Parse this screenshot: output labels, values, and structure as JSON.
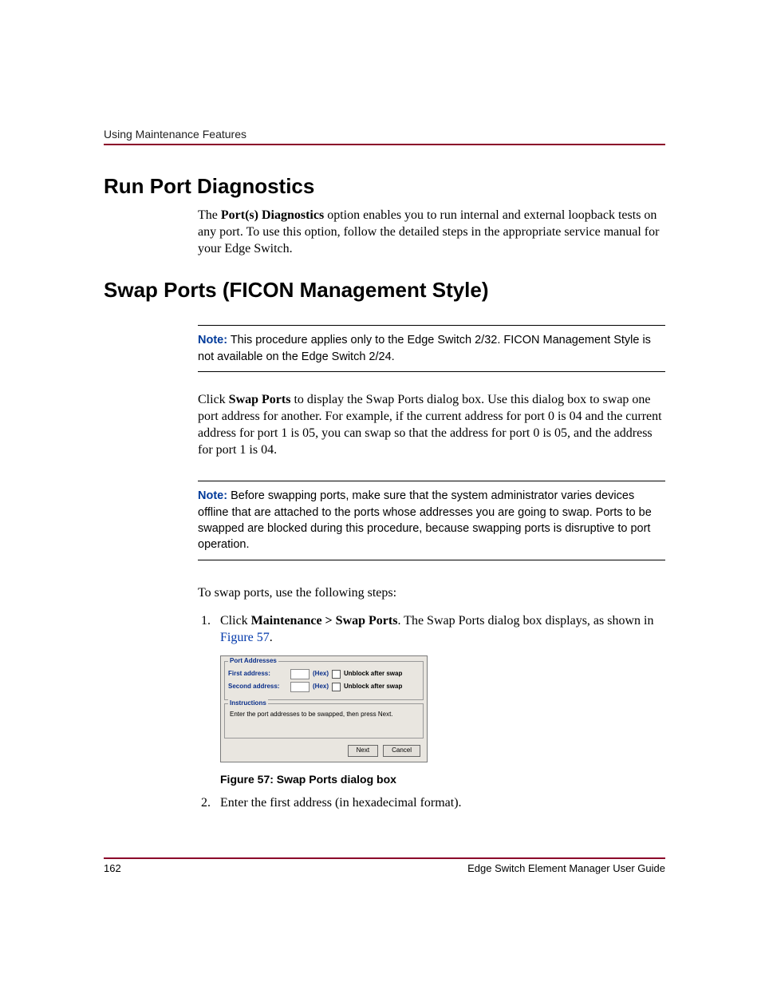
{
  "runningHead": "Using Maintenance Features",
  "section1": {
    "heading": "Run Port Diagnostics",
    "para_pre": "The ",
    "para_bold": "Port(s) Diagnostics",
    "para_post": " option enables you to run internal and external loopback tests on any port. To use this option, follow the detailed steps in the appropriate service manual for your Edge Switch."
  },
  "section2": {
    "heading": "Swap Ports (FICON Management Style)",
    "note1_label": "Note:",
    "note1_text": "  This procedure applies only to the Edge Switch 2/32. FICON Management Style is not available on the Edge Switch 2/24.",
    "para_pre": "Click ",
    "para_bold": "Swap Ports",
    "para_post": " to display the Swap Ports dialog box. Use this dialog box to swap one port address for another. For example, if the current address for port 0 is 04 and the current address for port 1 is 05, you can swap so that the address for port 0 is 05, and the address for port 1 is 04.",
    "note2_label": "Note:",
    "note2_text": "  Before swapping ports, make sure that the system administrator varies devices offline that are attached to the ports whose addresses you are going to swap. Ports to be swapped are blocked during this procedure, because swapping ports is disruptive to port operation.",
    "lead": "To swap ports, use the following steps:",
    "step1_pre": "Click ",
    "step1_bold": "Maintenance > Swap Ports",
    "step1_mid": ". The Swap Ports dialog box displays, as shown in ",
    "step1_link": "Figure 57",
    "step1_post": ".",
    "step2": "Enter the first address (in hexadecimal format).",
    "figcap": "Figure 57:  Swap Ports dialog box"
  },
  "dialog": {
    "group1_legend": "Port Addresses",
    "row1_label": "First address:",
    "row2_label": "Second address:",
    "hex": "(Hex)",
    "unblock": "Unblock after swap",
    "group2_legend": "Instructions",
    "instructions": "Enter the port addresses to be swapped, then press Next.",
    "btn_next": "Next",
    "btn_cancel": "Cancel"
  },
  "footer": {
    "pageNum": "162",
    "guide": "Edge Switch Element Manager User Guide"
  }
}
